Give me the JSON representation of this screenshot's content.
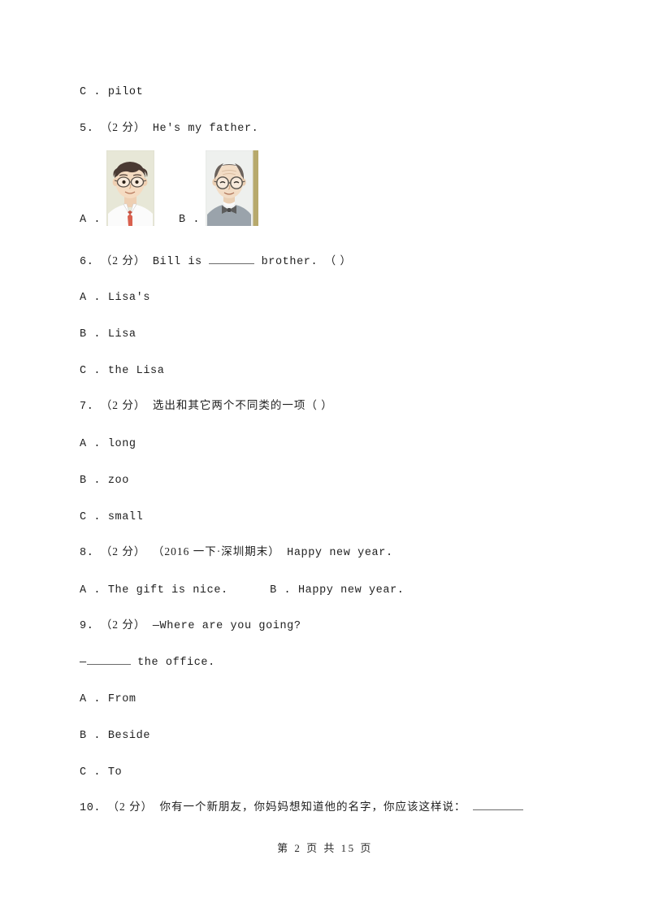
{
  "document": {
    "type": "exam-paper",
    "language": "zh-CN/en",
    "background_color": "#ffffff",
    "text_color": "#1f1f1f"
  },
  "continued_option": {
    "label": "C .",
    "text": "pilot"
  },
  "questions": [
    {
      "number": "5.",
      "score": "（2 分）",
      "stem": "He's my father.",
      "type": "picture-choice",
      "options": [
        {
          "label": "A .",
          "image": {
            "name": "cartoon-father-portrait",
            "description": "cartoon man with dark hair, glasses, white shirt and red tie",
            "background_color": "#e6e6d6",
            "skin_color": "#f4d9bf",
            "hair_color": "#4a3a33",
            "shirt_color": "#fbfbfb",
            "tie_color": "#d9604e"
          }
        },
        {
          "label": "B .",
          "image": {
            "name": "cartoon-grandfather-portrait",
            "description": "cartoon older man with round glasses, bow tie and grey sweater",
            "background_color": "#eef0ee",
            "border_color": "#b5a66a",
            "skin_color": "#f2dcc5",
            "hair_color": "#6b625c",
            "sweater_color": "#9aa3ab",
            "bowtie_color": "#5d5d5d"
          }
        }
      ]
    },
    {
      "number": "6.",
      "score": "（2 分）",
      "stem_before": "Bill is",
      "stem_after": "brother.",
      "answer_bracket": "（      ）",
      "options": [
        {
          "label": "A .",
          "text": "Lisa's"
        },
        {
          "label": "B .",
          "text": "Lisa"
        },
        {
          "label": "C .",
          "text": "the Lisa"
        }
      ]
    },
    {
      "number": "7.",
      "score": "（2 分）",
      "stem": "选出和其它两个不同类的一项（      ）",
      "options": [
        {
          "label": "A .",
          "text": "long"
        },
        {
          "label": "B .",
          "text": "zoo"
        },
        {
          "label": "C .",
          "text": "small"
        }
      ]
    },
    {
      "number": "8.",
      "score": "（2 分）",
      "source": "（2016 一下·深圳期末）",
      "stem": "Happy new year.",
      "options_inline": [
        {
          "label": "A .",
          "text": "The gift is nice."
        },
        {
          "label": "B .",
          "text": "Happy new year."
        }
      ]
    },
    {
      "number": "9.",
      "score": "（2 分）",
      "stem_line1": "—Where are you going?",
      "stem_line2_before": "—",
      "stem_line2_after": "the office.",
      "options": [
        {
          "label": "A .",
          "text": "From"
        },
        {
          "label": "B .",
          "text": "Beside"
        },
        {
          "label": "C .",
          "text": "To"
        }
      ]
    },
    {
      "number": "10.",
      "score": "（2 分）",
      "stem": "你有一个新朋友，你妈妈想知道他的名字，你应该这样说："
    }
  ],
  "footer": {
    "text": "第 2 页 共 15 页",
    "page_current": "2",
    "page_total": "15"
  }
}
